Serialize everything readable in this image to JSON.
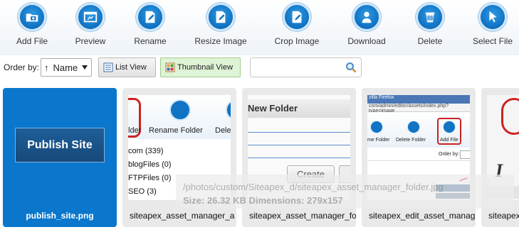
{
  "toolbar": {
    "items": [
      {
        "label": "Add File",
        "icon": "add-file-icon"
      },
      {
        "label": "Preview",
        "icon": "preview-icon"
      },
      {
        "label": "Rename",
        "icon": "rename-icon"
      },
      {
        "label": "Resize Image",
        "icon": "resize-image-icon"
      },
      {
        "label": "Crop Image",
        "icon": "crop-image-icon"
      },
      {
        "label": "Download",
        "icon": "download-icon"
      },
      {
        "label": "Delete",
        "icon": "delete-icon"
      },
      {
        "label": "Select File",
        "icon": "select-file-icon"
      }
    ]
  },
  "filter": {
    "order_label": "Order by:",
    "order_value": "Name",
    "order_arrow": "↑",
    "list_view_label": "List View",
    "thumbnail_view_label": "Thumbnail View",
    "search_placeholder": ""
  },
  "thumbnails": [
    {
      "filename": "publish_site.png",
      "button_text": "Publish Site"
    },
    {
      "filename": "siteapex_asset_manager_a",
      "preview": {
        "left_label": "lder",
        "center_label": "Rename Folder",
        "right_label": "Dele",
        "list": [
          "com (339)",
          "blogFiles (0)",
          "FTPFiles (0)",
          "SEO (3)"
        ]
      }
    },
    {
      "filename": "siteapex_asset_manager_fo",
      "preview": {
        "title": "New Folder",
        "button": "Create"
      }
    },
    {
      "filename": "siteapex_edit_asset_manag",
      "preview": {
        "window_title": "zilla Firefox",
        "url": "com/admin/editor/assets/index.php?type=image",
        "labels": [
          "me Folder",
          "Delete Folder",
          "Add File"
        ],
        "order_label": "Order by:"
      }
    },
    {
      "filename": "siteapex",
      "preview": {
        "letter": "I"
      }
    }
  ],
  "hover": {
    "path": "/photos/custom/Siteapex_d/siteapex_asset_manager_folder.jpg",
    "details": "Size: 26.32 KB Dimensions: 279x157"
  },
  "colors": {
    "accent_blue": "#1173c4",
    "selected_card": "#0a77cc",
    "thumbnail_view_bg": "#dff3d6",
    "highlight_red": "#cc2222"
  }
}
